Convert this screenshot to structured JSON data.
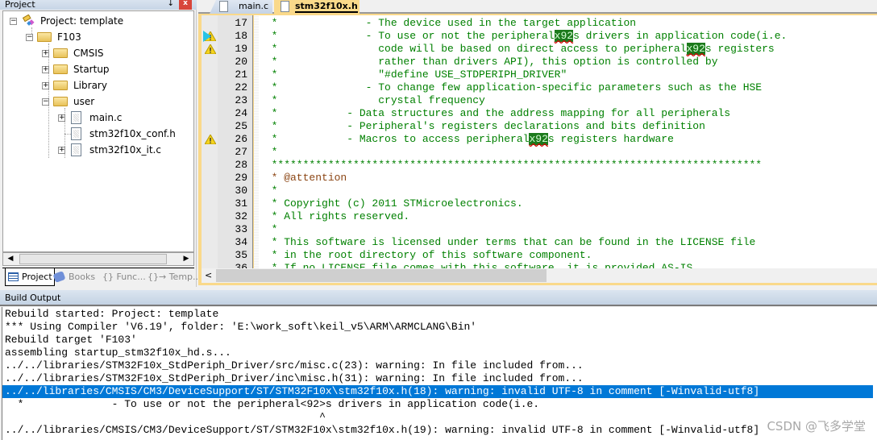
{
  "project_panel": {
    "title": "Project",
    "pin_glyph": "↓",
    "close_glyph": "x",
    "tree": [
      {
        "label": "Project: template",
        "icon": "project-icon",
        "expander": "−"
      },
      {
        "label": "F103",
        "icon": "target-folder-icon",
        "expander": "−"
      },
      {
        "label": "CMSIS",
        "icon": "folder-icon",
        "expander": "+"
      },
      {
        "label": "Startup",
        "icon": "folder-icon",
        "expander": "+"
      },
      {
        "label": "Library",
        "icon": "folder-icon",
        "expander": "+"
      },
      {
        "label": "user",
        "icon": "folder-open-icon",
        "expander": "−"
      },
      {
        "label": "main.c",
        "icon": "file-icon",
        "expander": "+"
      },
      {
        "label": "stm32f10x_conf.h",
        "icon": "file-icon",
        "expander": ""
      },
      {
        "label": "stm32f10x_it.c",
        "icon": "file-icon",
        "expander": "+"
      }
    ],
    "bottom_tabs": [
      {
        "label": "Project",
        "active": true,
        "icon": "project-tab-icon"
      },
      {
        "label": "Books",
        "active": false,
        "icon": "books-icon"
      },
      {
        "label": "{} Func...",
        "active": false,
        "icon": "functions-icon"
      },
      {
        "label": "{}→ Temp...",
        "active": false,
        "icon": "templates-icon"
      }
    ],
    "scroll_left": "◀",
    "scroll_right": "▶"
  },
  "editor": {
    "tabs": [
      {
        "label": "main.c",
        "active": false
      },
      {
        "label": "stm32f10x.h",
        "active": true
      }
    ],
    "lines": [
      {
        "no": "17",
        "warn": false,
        "marker": false,
        "text": "  *              - The device used in the target application",
        "highlights": []
      },
      {
        "no": "18",
        "warn": true,
        "marker": true,
        "text": "  *              - To use or not the peripheral",
        "hl": "x92",
        "after": "s drivers in application code(i.e."
      },
      {
        "no": "19",
        "warn": true,
        "marker": false,
        "text": "  *                code will be based on direct access to peripheral",
        "hl": "x92",
        "after": "s registers"
      },
      {
        "no": "20",
        "warn": false,
        "marker": false,
        "text": "  *                rather than drivers API), this option is controlled by"
      },
      {
        "no": "21",
        "warn": false,
        "marker": false,
        "text": "  *                \"#define USE_STDPERIPH_DRIVER\""
      },
      {
        "no": "22",
        "warn": false,
        "marker": false,
        "text": "  *              - To change few application-specific parameters such as the HSE"
      },
      {
        "no": "23",
        "warn": false,
        "marker": false,
        "text": "  *                crystal frequency"
      },
      {
        "no": "24",
        "warn": false,
        "marker": false,
        "text": "  *           - Data structures and the address mapping for all peripherals"
      },
      {
        "no": "25",
        "warn": false,
        "marker": false,
        "text": "  *           - Peripheral's registers declarations and bits definition"
      },
      {
        "no": "26",
        "warn": true,
        "marker": false,
        "text": "  *           - Macros to access peripheral",
        "hl": "x92",
        "after": "s registers hardware"
      },
      {
        "no": "27",
        "warn": false,
        "marker": false,
        "text": "  *"
      },
      {
        "no": "28",
        "warn": false,
        "marker": false,
        "text": "  ******************************************************************************"
      },
      {
        "no": "29",
        "warn": false,
        "marker": false,
        "text": "  * @attention",
        "brown": true
      },
      {
        "no": "30",
        "warn": false,
        "marker": false,
        "text": "  *"
      },
      {
        "no": "31",
        "warn": false,
        "marker": false,
        "text": "  * Copyright (c) 2011 STMicroelectronics."
      },
      {
        "no": "32",
        "warn": false,
        "marker": false,
        "text": "  * All rights reserved."
      },
      {
        "no": "33",
        "warn": false,
        "marker": false,
        "text": "  *"
      },
      {
        "no": "34",
        "warn": false,
        "marker": false,
        "text": "  * This software is licensed under terms that can be found in the LICENSE file"
      },
      {
        "no": "35",
        "warn": false,
        "marker": false,
        "text": "  * in the root directory of this software component."
      },
      {
        "no": "36",
        "warn": false,
        "marker": false,
        "text": "  * If no LICENSE file comes with this software, it is provided AS-IS."
      }
    ],
    "scroll_left": "<"
  },
  "build_output": {
    "title": "Build Output",
    "selected_index": 7,
    "lines": [
      "Rebuild started: Project: template",
      "*** Using Compiler 'V6.19', folder: 'E:\\work_soft\\keil_v5\\ARM\\ARMCLANG\\Bin'",
      "Rebuild target 'F103'",
      "assembling startup_stm32f10x_hd.s...",
      "../../libraries/STM32F10x_StdPeriph_Driver/src/misc.c(23): warning: In file included from...",
      "../../libraries/STM32F10x_StdPeriph_Driver/inc\\misc.h(31): warning: In file included from...",
      "../../libraries/CMSIS/CM3/DeviceSupport/ST/STM32F10x\\stm32f10x.h(18): warning: invalid UTF-8 in comment [-Winvalid-utf8]",
      "  *              - To use or not the peripheral<92>s drivers in application code(i.e.",
      "                                                  ^",
      "../../libraries/CMSIS/CM3/DeviceSupport/ST/STM32F10x\\stm32f10x.h(19): warning: invalid UTF-8 in comment [-Winvalid-utf8]"
    ]
  },
  "watermark": "CSDN @飞多学堂"
}
